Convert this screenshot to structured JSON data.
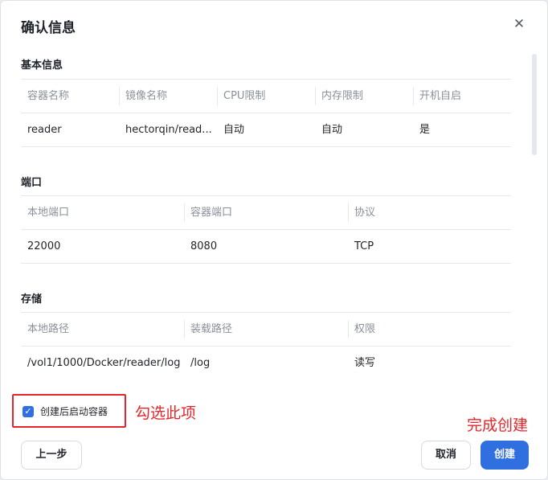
{
  "dialog": {
    "title": "确认信息",
    "close_icon": "close-icon"
  },
  "basic": {
    "title": "基本信息",
    "columns": [
      "容器名称",
      "镜像名称",
      "CPU限制",
      "内存限制",
      "开机自启"
    ],
    "row": [
      "reader",
      "hectorqin/read...",
      "自动",
      "自动",
      "是"
    ]
  },
  "ports": {
    "title": "端口",
    "columns": [
      "本地端口",
      "容器端口",
      "协议"
    ],
    "row": [
      "22000",
      "8080",
      "TCP"
    ]
  },
  "storage": {
    "title": "存储",
    "columns": [
      "本地路径",
      "装载路径",
      "权限"
    ],
    "row": [
      "/vol1/1000/Docker/reader/log",
      "/log",
      "读写"
    ]
  },
  "footer": {
    "checkbox_label": "创建后启动容器",
    "checkbox_checked": true,
    "annotation_checkbox": "勾选此项",
    "annotation_create": "完成创建",
    "prev_label": "上一步",
    "cancel_label": "取消",
    "create_label": "创建"
  },
  "colors": {
    "accent": "#2f6fdf",
    "annotation": "#e3262b"
  }
}
